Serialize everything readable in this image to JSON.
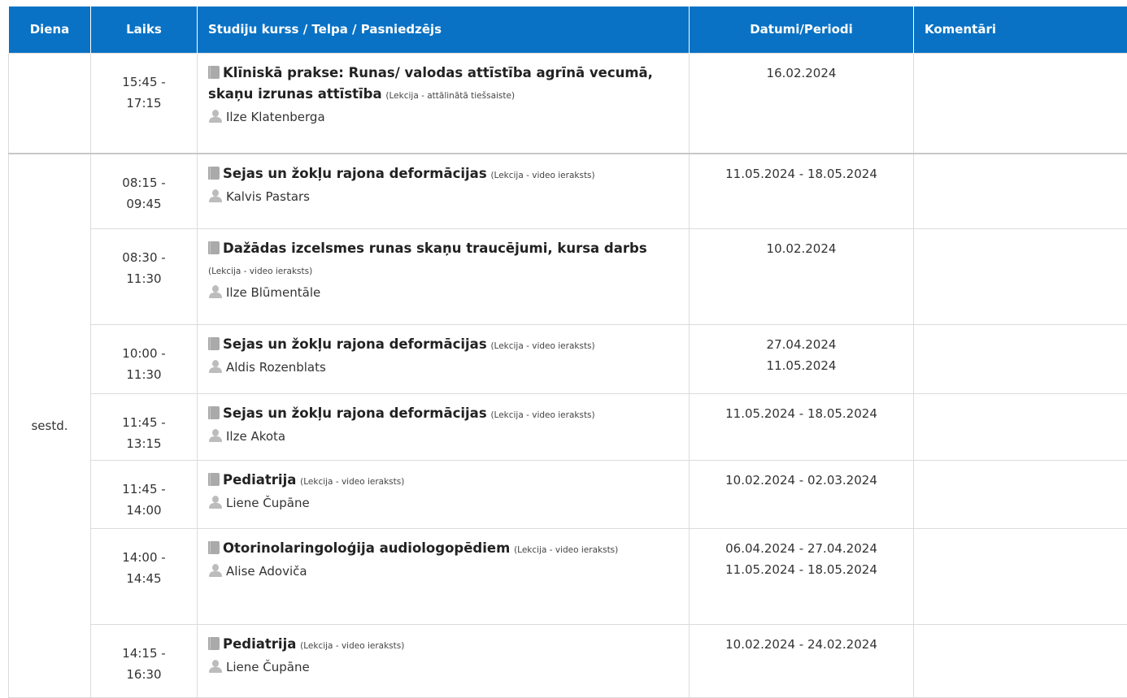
{
  "headers": {
    "day": "Diena",
    "time": "Laiks",
    "course": "Studiju kurss / Telpa / Pasniedzējs",
    "dates": "Datumi/Periodi",
    "comments": "Komentāri"
  },
  "rows": [
    {
      "time_start": "15:45 -",
      "time_end": "17:15",
      "title": "Klīniskā prakse: Runas/ valodas attīstība agrīnā vecumā, skaņu izrunas attīstība",
      "type": "(Lekcija - attālinātā tiešsaiste)",
      "teacher": "Ilze Klatenberga",
      "dates": [
        "16.02.2024"
      ],
      "comment": ""
    },
    {
      "time_start": "08:15 -",
      "time_end": "09:45",
      "title": "Sejas un žokļu rajona deformācijas",
      "type": "(Lekcija - video ieraksts)",
      "teacher": "Kalvis Pastars",
      "dates": [
        "11.05.2024 - 18.05.2024"
      ],
      "comment": ""
    },
    {
      "time_start": "08:30 -",
      "time_end": "11:30",
      "title": "Dažādas izcelsmes runas skaņu traucējumi, kursa darbs",
      "type": "(Lekcija - video ieraksts)",
      "teacher": "Ilze Blūmentāle",
      "dates": [
        "10.02.2024"
      ],
      "comment": ""
    },
    {
      "time_start": "10:00 -",
      "time_end": "11:30",
      "title": "Sejas un žokļu rajona deformācijas",
      "type": "(Lekcija - video ieraksts)",
      "teacher": "Aldis Rozenblats",
      "dates": [
        "27.04.2024",
        "11.05.2024"
      ],
      "comment": ""
    },
    {
      "time_start": "11:45 -",
      "time_end": "13:15",
      "title": "Sejas un žokļu rajona deformācijas",
      "type": "(Lekcija - video ieraksts)",
      "teacher": "Ilze Akota",
      "dates": [
        "11.05.2024 - 18.05.2024"
      ],
      "comment": ""
    },
    {
      "time_start": "11:45 -",
      "time_end": "14:00",
      "title": "Pediatrija",
      "type": "(Lekcija - video ieraksts)",
      "teacher": "Liene Čupāne",
      "dates": [
        "10.02.2024 - 02.03.2024"
      ],
      "comment": ""
    },
    {
      "time_start": "14:00 -",
      "time_end": "14:45",
      "title": "Otorinolaringoloģija audiologopēdiem",
      "type": "(Lekcija - video ieraksts)",
      "teacher": "Alise Adoviča",
      "dates": [
        "06.04.2024 - 27.04.2024",
        "11.05.2024 - 18.05.2024"
      ],
      "comment": ""
    },
    {
      "time_start": "14:15 -",
      "time_end": "16:30",
      "title": "Pediatrija",
      "type": "(Lekcija - video ieraksts)",
      "teacher": "Liene Čupāne",
      "dates": [
        "10.02.2024 - 24.02.2024"
      ],
      "comment": ""
    }
  ],
  "day_groups": [
    {
      "label": ""
    },
    {
      "label": "sestd."
    }
  ],
  "icons": {
    "course": "book-icon",
    "teacher": "user-icon"
  },
  "colors": {
    "header_bg": "#0a72c4",
    "header_text": "#ffffff",
    "border": "#dcdcdc"
  }
}
